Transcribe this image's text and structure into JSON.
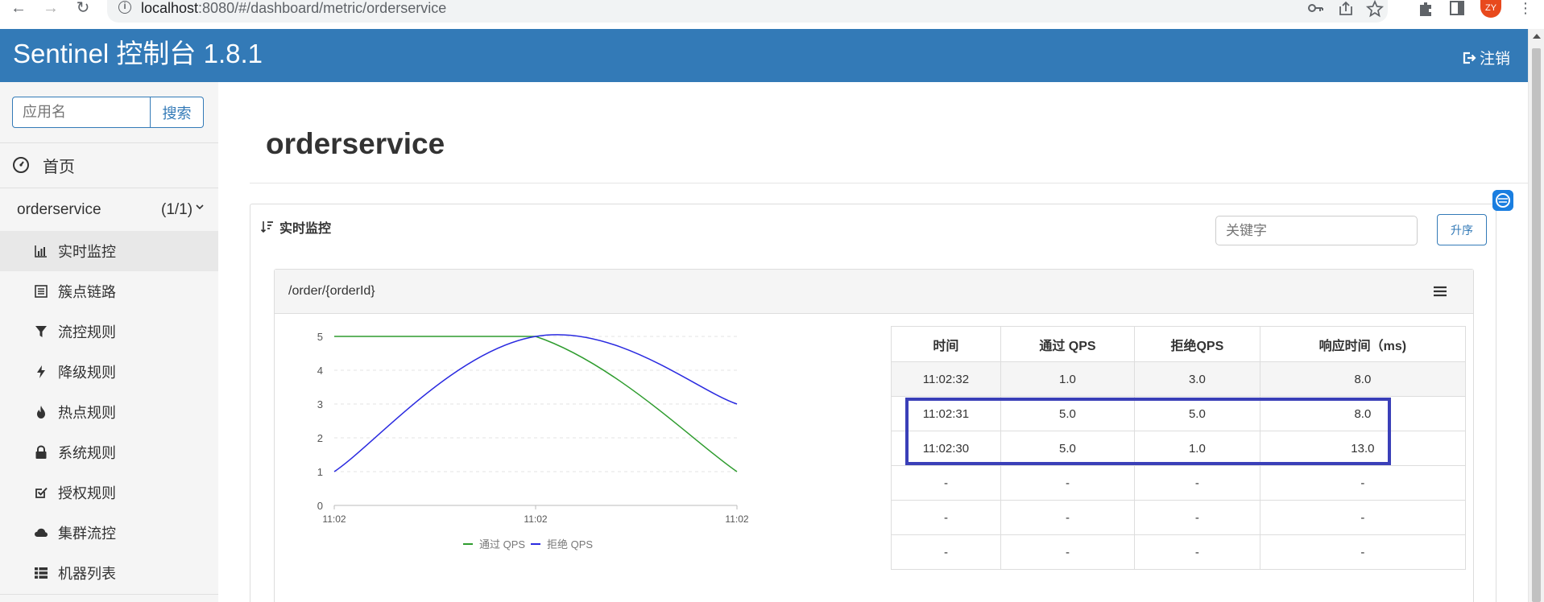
{
  "browser": {
    "url_host": "localhost",
    "url_path": ":8080/#/dashboard/metric/orderservice",
    "profile_initials": "ZY"
  },
  "header": {
    "brand": "Sentinel 控制台 1.8.1",
    "logout_label": "注销"
  },
  "sidebar": {
    "search_placeholder": "应用名",
    "search_button": "搜索",
    "home_label": "首页",
    "app": {
      "name": "orderservice",
      "count": "(1/1)"
    },
    "menu": [
      {
        "label": "实时监控",
        "icon": "bar-chart-icon",
        "active": true
      },
      {
        "label": "簇点链路",
        "icon": "list-icon",
        "active": false
      },
      {
        "label": "流控规则",
        "icon": "filter-icon",
        "active": false
      },
      {
        "label": "降级规则",
        "icon": "flash-icon",
        "active": false
      },
      {
        "label": "热点规则",
        "icon": "fire-icon",
        "active": false
      },
      {
        "label": "系统规则",
        "icon": "lock-icon",
        "active": false
      },
      {
        "label": "授权规则",
        "icon": "check-square-icon",
        "active": false
      },
      {
        "label": "集群流控",
        "icon": "cloud-icon",
        "active": false
      },
      {
        "label": "机器列表",
        "icon": "th-list-icon",
        "active": false
      }
    ]
  },
  "main": {
    "title": "orderservice",
    "panel_title": "实时监控",
    "keyword_placeholder": "关键字",
    "sort_button": "升序",
    "resource": "/order/{orderId}"
  },
  "colors": {
    "pass": "#2e9c2e",
    "block": "#2a2ae0",
    "highlight": "#3a3fb8",
    "brand": "#337ab7"
  },
  "chart_data": {
    "type": "line",
    "x": [
      "11:02",
      "11:02",
      "11:02"
    ],
    "ylim": [
      0,
      5
    ],
    "yticks": [
      "0",
      "1",
      "2",
      "3",
      "4",
      "5"
    ],
    "series": [
      {
        "name": "通过 QPS",
        "values": [
          5,
          5,
          1
        ]
      },
      {
        "name": "拒绝 QPS",
        "values": [
          1,
          5,
          3
        ]
      }
    ],
    "legend_position": "bottom"
  },
  "table": {
    "headers": [
      "时间",
      "通过 QPS",
      "拒绝QPS",
      "响应时间（ms)"
    ],
    "rows": [
      [
        "11:02:32",
        "1.0",
        "3.0",
        "8.0"
      ],
      [
        "11:02:31",
        "5.0",
        "5.0",
        "8.0"
      ],
      [
        "11:02:30",
        "5.0",
        "1.0",
        "13.0"
      ],
      [
        "-",
        "-",
        "-",
        "-"
      ],
      [
        "-",
        "-",
        "-",
        "-"
      ],
      [
        "-",
        "-",
        "-",
        "-"
      ]
    ]
  }
}
